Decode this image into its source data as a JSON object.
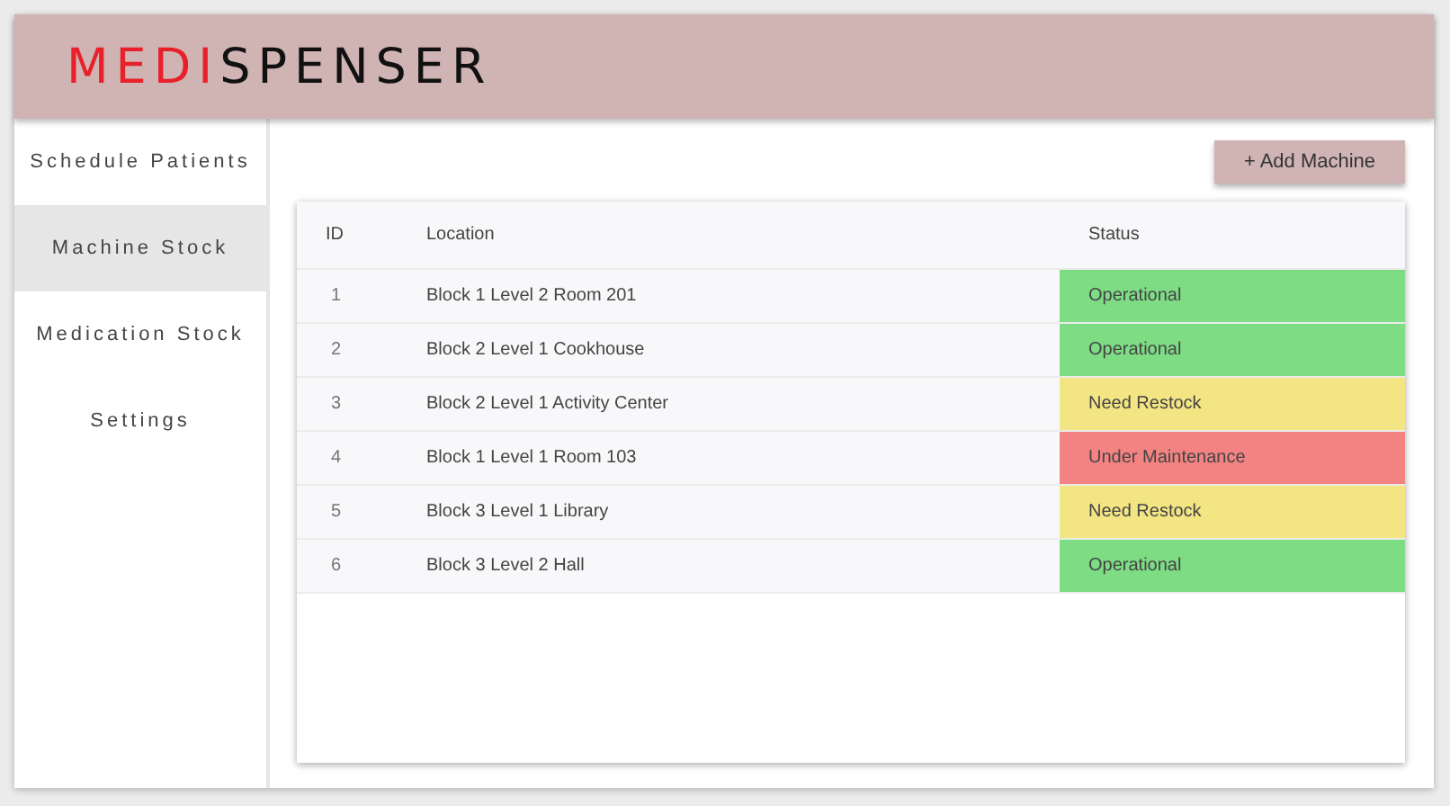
{
  "logo": {
    "accent": "MEDI",
    "rest": "SPENSER"
  },
  "sidebar": {
    "items": [
      {
        "label": "Schedule Patients",
        "selected": false
      },
      {
        "label": "Machine Stock",
        "selected": true
      },
      {
        "label": "Medication Stock",
        "selected": false
      },
      {
        "label": "Settings",
        "selected": false
      }
    ]
  },
  "add_button": "+ Add Machine",
  "table": {
    "columns": [
      "ID",
      "Location",
      "Status"
    ],
    "rows": [
      {
        "id": "1",
        "location": "Block 1 Level 2 Room 201",
        "status": "Operational",
        "color": "#7ddc84"
      },
      {
        "id": "2",
        "location": "Block 2 Level 1 Cookhouse",
        "status": "Operational",
        "color": "#7ddc84"
      },
      {
        "id": "3",
        "location": "Block 2 Level 1 Activity Center",
        "status": "Need Restock",
        "color": "#f3e583"
      },
      {
        "id": "4",
        "location": "Block 1 Level 1 Room 103",
        "status": "Under Maintenance",
        "color": "#f38383"
      },
      {
        "id": "5",
        "location": "Block 3 Level 1 Library",
        "status": "Need Restock",
        "color": "#f3e583"
      },
      {
        "id": "6",
        "location": "Block 3 Level 2 Hall",
        "status": "Operational",
        "color": "#7ddc84"
      }
    ]
  }
}
